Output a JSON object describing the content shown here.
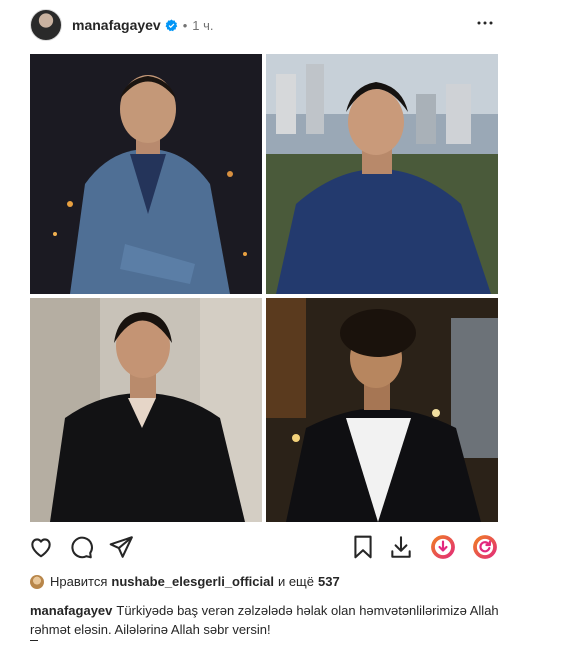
{
  "post": {
    "username": "manafagayev",
    "time": "1 ч.",
    "separator": "•"
  },
  "likes": {
    "prefix": "Нравится",
    "user": "nushabe_elesgerli_official",
    "connector": "и ещё",
    "count": "537"
  },
  "caption": {
    "username": "manafagayev",
    "text": "Türkiyədə baş verən zəlzələdə həlak olan həmvətənlilərimizə Allah rəhmət eləsin. Ailələrinə Allah səbr versin!"
  },
  "icons": {
    "verified": "verified-badge-icon",
    "more": "more-options-icon",
    "like": "heart-icon",
    "comment": "comment-icon",
    "share": "send-icon",
    "save": "bookmark-icon",
    "download": "download-icon",
    "ext1": "download-video-extension-icon",
    "ext2": "refresh-extension-icon"
  },
  "colors": {
    "verified": "#0095f6",
    "ext_orange": "#f0821e",
    "ext_pink": "#e2287e",
    "text": "#262626",
    "muted": "#737373"
  }
}
